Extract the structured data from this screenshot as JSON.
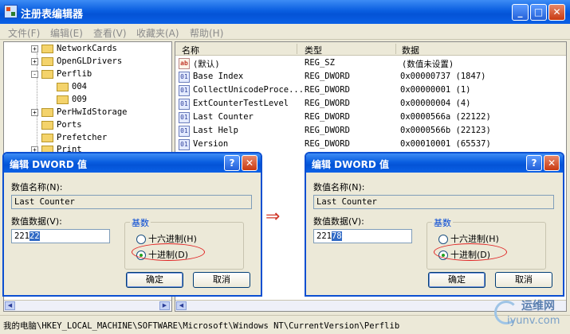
{
  "window": {
    "title": "注册表编辑器",
    "controls": {
      "minimize": "_",
      "maximize": "□",
      "close": "✕"
    }
  },
  "menu": [
    "文件(F)",
    "编辑(E)",
    "查看(V)",
    "收藏夹(A)",
    "帮助(H)"
  ],
  "tree": {
    "items": [
      {
        "label": "NetworkCards",
        "expander": "+"
      },
      {
        "label": "OpenGLDrivers",
        "expander": "+"
      },
      {
        "label": "Perflib",
        "expander": "-"
      },
      {
        "label": "004",
        "expander": ""
      },
      {
        "label": "009",
        "expander": ""
      },
      {
        "label": "PerHwIdStorage",
        "expander": "+"
      },
      {
        "label": "Ports",
        "expander": ""
      },
      {
        "label": "Prefetcher",
        "expander": ""
      },
      {
        "label": "Print",
        "expander": "+"
      }
    ]
  },
  "list": {
    "columns": [
      "名称",
      "类型",
      "数据"
    ],
    "rows": [
      {
        "icon": "ab",
        "name": "(默认)",
        "type": "REG_SZ",
        "data": "(数值未设置)"
      },
      {
        "icon": "01",
        "name": "Base Index",
        "type": "REG_DWORD",
        "data": "0x00000737 (1847)"
      },
      {
        "icon": "01",
        "name": "CollectUnicodeProce...",
        "type": "REG_DWORD",
        "data": "0x00000001 (1)"
      },
      {
        "icon": "01",
        "name": "ExtCounterTestLevel",
        "type": "REG_DWORD",
        "data": "0x00000004 (4)"
      },
      {
        "icon": "01",
        "name": "Last Counter",
        "type": "REG_DWORD",
        "data": "0x0000566a (22122)"
      },
      {
        "icon": "01",
        "name": "Last Help",
        "type": "REG_DWORD",
        "data": "0x0000566b (22123)"
      },
      {
        "icon": "01",
        "name": "Version",
        "type": "REG_DWORD",
        "data": "0x00010001 (65537)"
      }
    ]
  },
  "status_path": "我的电脑\\HKEY_LOCAL_MACHINE\\SOFTWARE\\Microsoft\\Windows NT\\CurrentVersion\\Perflib",
  "dialog_left": {
    "title": "编辑 DWORD 值",
    "name_label": "数值名称(N):",
    "name_value": "Last Counter",
    "data_label": "数值数据(V):",
    "data_value_plain": "221",
    "data_value_selected": "22",
    "base_label": "基数",
    "hex_label": "十六进制(H)",
    "dec_label": "十进制(D)",
    "ok_label": "确定",
    "cancel_label": "取消"
  },
  "dialog_right": {
    "title": "编辑 DWORD 值",
    "name_label": "数值名称(N):",
    "name_value": "Last Counter",
    "data_label": "数值数据(V):",
    "data_value_plain": "221",
    "data_value_selected": "78",
    "base_label": "基数",
    "hex_label": "十六进制(H)",
    "dec_label": "十进制(D)",
    "ok_label": "确定",
    "cancel_label": "取消"
  },
  "arrow": "⇒",
  "watermark": {
    "top": "运维网",
    "bottom": "iyunv.com"
  },
  "colors": {
    "titlebar": "#0a5ee0",
    "highlight": "#e02020",
    "selection": "#316ac5"
  }
}
